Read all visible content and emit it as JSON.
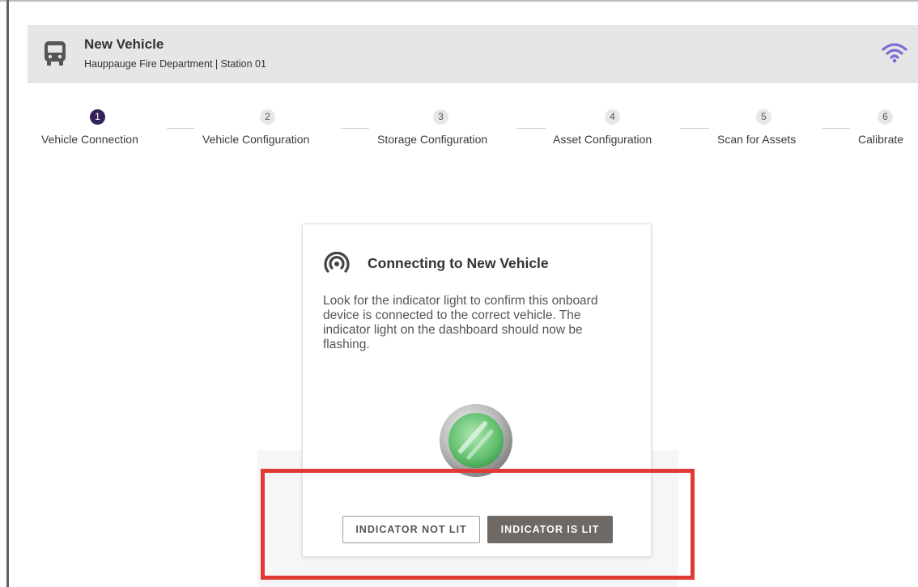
{
  "header": {
    "title": "New Vehicle",
    "subtitle": "Hauppauge Fire Department | Station 01",
    "icon": "bus-icon",
    "status_icon": "wifi-icon",
    "accent_color": "#7b6fd8"
  },
  "stepper": {
    "active_index": 0,
    "active_color": "#34235a",
    "steps": [
      {
        "number": "1",
        "label": "Vehicle Connection"
      },
      {
        "number": "2",
        "label": "Vehicle Configuration"
      },
      {
        "number": "3",
        "label": "Storage Configuration"
      },
      {
        "number": "4",
        "label": "Asset Configuration"
      },
      {
        "number": "5",
        "label": "Scan for Assets"
      },
      {
        "number": "6",
        "label": "Calibrate"
      }
    ]
  },
  "card": {
    "icon": "signal-broadcast-icon",
    "title": "Connecting to New Vehicle",
    "body": "Look for the indicator light to confirm this onboard device is connected to the correct vehicle. The indicator light on the dashboard should now be flashing.",
    "indicator": "green-indicator-light",
    "buttons": {
      "not_lit": "INDICATOR NOT LIT",
      "is_lit": "INDICATOR IS LIT"
    }
  },
  "annotation": {
    "highlight_color": "#e03a35"
  }
}
